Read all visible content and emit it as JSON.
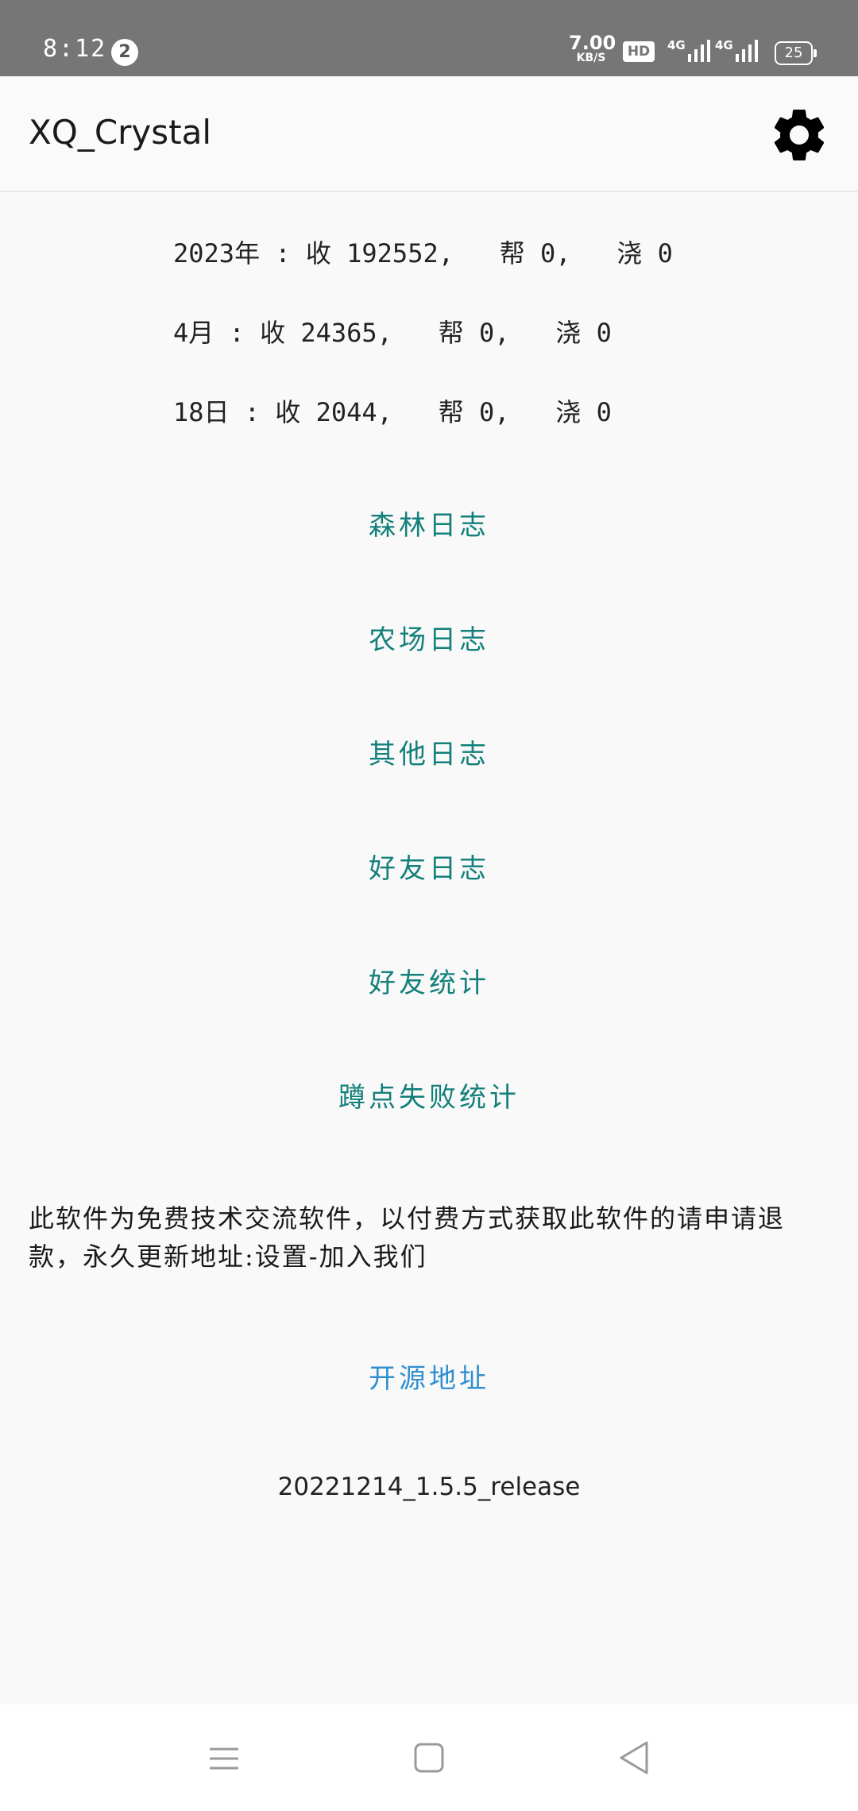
{
  "status_bar": {
    "time": "8:12",
    "notification_count": "2",
    "net_speed_value": "7.00",
    "net_speed_unit": "KB/S",
    "hd_label": "HD",
    "signal_1_label": "4G",
    "signal_2_label": "4G",
    "battery_level": "25"
  },
  "app_bar": {
    "title": "XQ_Crystal",
    "settings_icon": "gear-icon"
  },
  "stats": {
    "year": "2023年 : 收 192552,   帮 0,   浇 0",
    "month": "4月 : 收 24365,   帮 0,   浇 0",
    "day": "18日 : 收 2044,   帮 0,   浇 0"
  },
  "links": {
    "forest_log": "森林日志",
    "farm_log": "农场日志",
    "other_log": "其他日志",
    "friend_log": "好友日志",
    "friend_stats": "好友统计",
    "squat_fail_stats": "蹲点失败统计"
  },
  "notice": "此软件为免费技术交流软件，以付费方式获取此软件的请申请退款，永久更新地址:设置-加入我们",
  "source_link": "开源地址",
  "version": "20221214_1.5.5_release",
  "colors": {
    "link_teal": "#13807a",
    "link_blue": "#2f8fd0",
    "status_bar_bg": "#767676"
  },
  "nav_bar": {
    "menu_icon": "menu-icon",
    "home_icon": "home-square-icon",
    "back_icon": "back-triangle-icon"
  }
}
